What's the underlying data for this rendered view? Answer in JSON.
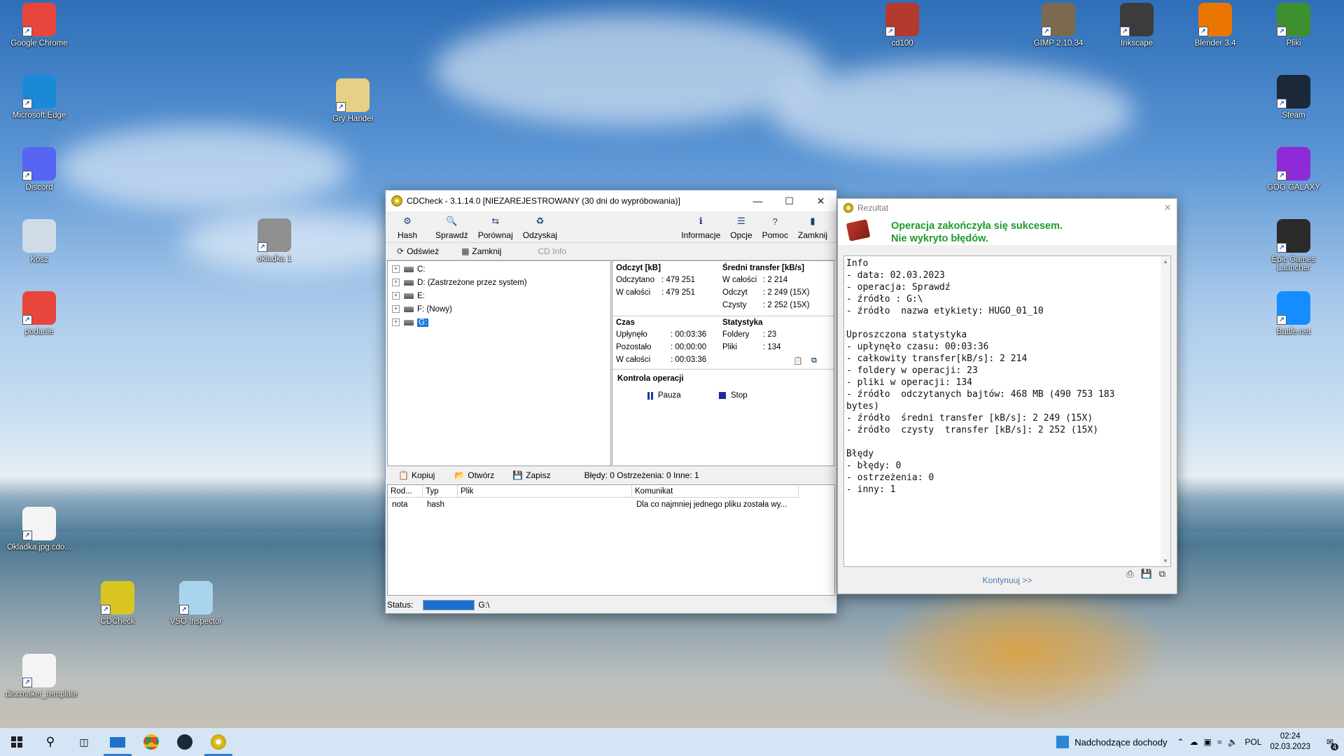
{
  "desktop": {
    "icons": [
      {
        "label": "Google Chrome",
        "color": "#e8453c"
      },
      {
        "label": "Microsoft Edge",
        "color": "#1a8ad6"
      },
      {
        "label": "Discord",
        "color": "#5865f2"
      },
      {
        "label": "Kosz",
        "color": "#cfdbe6"
      },
      {
        "label": "podanie",
        "color": "#e8453c"
      },
      {
        "label": "Gry Handel",
        "color": "#e6cf86"
      },
      {
        "label": "okladka 1",
        "color": "#8f8f8f"
      },
      {
        "label": "Okladka.jpg.cdo...",
        "color": "#f4f4f4"
      },
      {
        "label": "CDCheck",
        "color": "#d9c521"
      },
      {
        "label": "VSO Inspector",
        "color": "#aad4ee"
      },
      {
        "label": "discmaker_template",
        "color": "#f4f4f4"
      },
      {
        "label": "cd100",
        "color": "#b43a2f"
      },
      {
        "label": "GIMP 2.10.34",
        "color": "#7b6a4f"
      },
      {
        "label": "Inkscape",
        "color": "#3c3c3c"
      },
      {
        "label": "Blender 3.4",
        "color": "#ea7600"
      },
      {
        "label": "Pliki",
        "color": "#3e8f2f"
      },
      {
        "label": "Steam",
        "color": "#1b2838"
      },
      {
        "label": "GOG GALAXY",
        "color": "#8e2bd6"
      },
      {
        "label": "Epic Games Launcher",
        "color": "#2a2a2a"
      },
      {
        "label": "Battle.net",
        "color": "#148eff"
      }
    ]
  },
  "cdcheck": {
    "title": "CDCheck - 3.1.14.0 [NIEZAREJESTROWANY (30 dni do wypróbowania)]",
    "toolbar": [
      "Hash",
      "Sprawdź",
      "Porównaj",
      "Odzyskaj",
      "Informacje",
      "Opcje",
      "Pomoc",
      "Zamknij"
    ],
    "subtoolbar": {
      "refresh": "Odśwież",
      "close": "Zamknij",
      "cdinfo": "CD Info"
    },
    "tree": [
      "C:",
      "D: (Zastrzeżone przez system)",
      "E:",
      "F: (Nowy)",
      "G:"
    ],
    "read": {
      "header": "Odczyt [kB]",
      "read_label": "Odczytano",
      "read_value": ": 479 251",
      "total_label": "W całości",
      "total_value": ": 479 251"
    },
    "transfer": {
      "header": "Średni transfer [kB/s]",
      "total_label": "W całości",
      "total_value": ": 2 214",
      "read_label": "Odczyt",
      "read_value": ": 2 249 (15X)",
      "clean_label": "Czysty",
      "clean_value": ": 2 252 (15X)"
    },
    "time": {
      "header": "Czas",
      "elapsed_label": "Upłynęło",
      "elapsed_value": ": 00:03:36",
      "remaining_label": "Pozostało",
      "remaining_value": ": 00:00:00",
      "total_label": "W całości",
      "total_value": ": 00:03:36"
    },
    "stats": {
      "header": "Statystyka",
      "folders_label": "Foldery",
      "folders_value": ": 23",
      "files_label": "Pliki",
      "files_value": ": 134"
    },
    "control": {
      "header": "Kontrola operacji",
      "pause": "Pauza",
      "stop": "Stop"
    },
    "lower": {
      "copy": "Kopiuj",
      "open": "Otwórz",
      "save": "Zapisz",
      "summary": "Błędy: 0 Ostrzeżenia: 0 Inne: 1"
    },
    "grid": {
      "headers": [
        "Rod...",
        "Typ",
        "Plik",
        "Komunikat"
      ],
      "row": [
        "nota",
        "hash",
        "",
        "Dla co najmniej jednego pliku została wy..."
      ]
    },
    "status": {
      "label": "Status:",
      "path": "G:\\"
    }
  },
  "result": {
    "title": "Rezultat",
    "msg1": "Operacja zakończyła się sukcesem.",
    "msg2": "Nie wykryto błędów.",
    "lines": [
      "Info",
      "- data: 02.03.2023",
      "- operacja: Sprawdź",
      "- źródło : G:\\",
      "- źródło  nazwa etykiety: HUGO_01_10",
      "",
      "Uproszczona statystyka",
      "- upłynęło czasu: 00:03:36",
      "- całkowity transfer[kB/s]: 2 214",
      "- foldery w operacji: 23",
      "- pliki w operacji: 134",
      "- źródło  odczytanych bajtów: 468 MB (490 753 183",
      "bytes)",
      "- źródło  średni transfer [kB/s]: 2 249 (15X)",
      "- źródło  czysty  transfer [kB/s]: 2 252 (15X)",
      "",
      "Błędy",
      "- błędy: 0",
      "- ostrzeżenia: 0",
      "- inny: 1"
    ],
    "continue": "Kontynuuj >>"
  },
  "taskbar": {
    "notification": "Nadchodzące dochody",
    "lang": "POL",
    "time": "02:24",
    "date": "02.03.2023",
    "badge": "4"
  }
}
